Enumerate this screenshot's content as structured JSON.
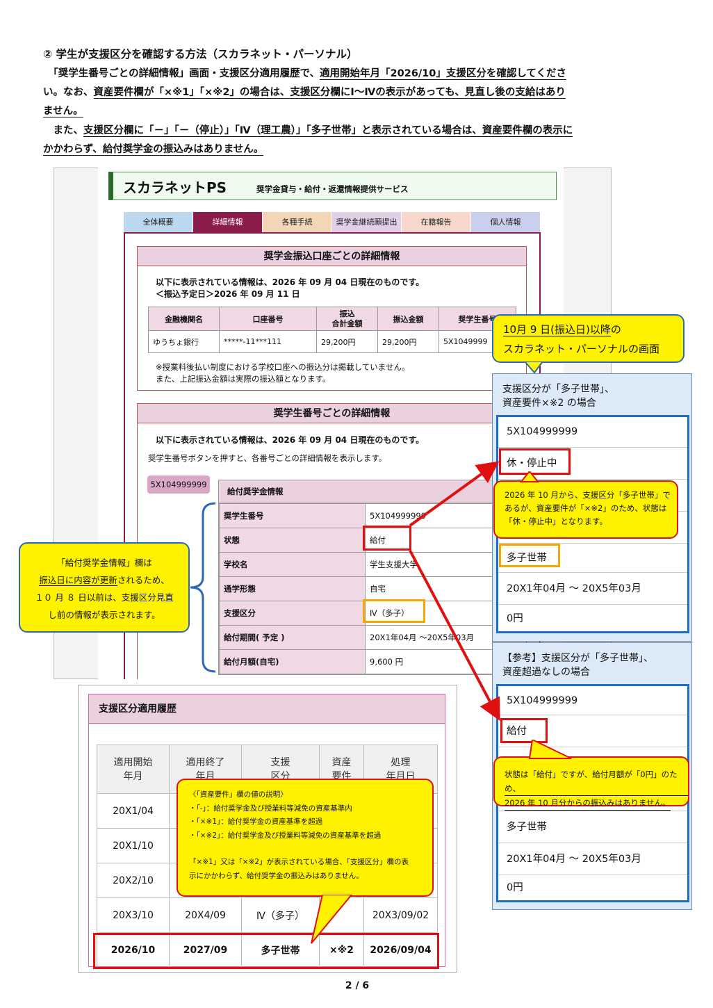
{
  "heading": "② 学生が支援区分を確認する方法（スカラネット・パーソナル）",
  "para1": {
    "a": "「奨学生番号ごとの詳細情報」画面・支援区分適用履歴で、",
    "b": "適用開始年月「2026/10」支援区分を確認してくださ",
    "c": "い。なお、",
    "d": "資産要件欄が「×※1」「×※2」の場合は、支援区分欄にⅠ～Ⅳの表示があっても、見直し後の支給はあり",
    "e": "ません。"
  },
  "para2": {
    "a": "また、",
    "b": "支援区分欄に「－」「－（停止）」「Ⅳ（理工農）」「多子世帯」と表示されている場合は、資産要件欄の表示に",
    "c": "かかわらず、給付奨学金の振込みはありません。"
  },
  "portal": {
    "brand": "スカラネットPS",
    "subtitle": "奨学金貸与・給付・返還情報提供サービス",
    "tabs": [
      "全体概要",
      "詳細情報",
      "各種手続",
      "奨学金継続願提出",
      "在籍報告",
      "個人情報"
    ],
    "tab_colors": [
      "#bcd8ee",
      "#8c1c4c",
      "#f3d6b8",
      "#e4cfe8",
      "#f8d8cc",
      "#c8d0ee"
    ],
    "account_section": {
      "title": "奨学金振込口座ごとの詳細情報",
      "note1": "以下に表示されている情報は、2026 年 09 月 04 日現在のものです。",
      "note2": "＜振込予定日＞2026 年 09 月 11 日",
      "headers": [
        "金融機関名",
        "口座番号",
        "振込\n合計金額",
        "振込金額",
        "奨学生番号"
      ],
      "row": [
        "ゆうちょ銀行",
        "*****-11***111",
        "29,200円",
        "29,200円",
        "5X1049999"
      ],
      "footnote1": "※授業料後払い制度における学校口座への振込分は掲載していません。",
      "footnote2": "また、上記振込金額は実際の振込額となります。"
    },
    "student_section": {
      "title": "奨学生番号ごとの詳細情報",
      "note1": "以下に表示されている情報は、2026 年 09 月 04 日現在のものです。",
      "note2": "奨学生番号ボタンを押すと、各番号ごとの詳細情報を表示します。",
      "button": "5X104999999"
    },
    "grant_info": {
      "title": "給付奨学金情報",
      "rows": [
        {
          "label": "奨学生番号",
          "value": "5X104999999"
        },
        {
          "label": "状態",
          "value": "給付"
        },
        {
          "label": "学校名",
          "value": "学生支援大学"
        },
        {
          "label": "通学形態",
          "value": "自宅"
        },
        {
          "label": "支援区分",
          "value": "Ⅳ（多子）"
        },
        {
          "label": "給付期間( 予定 )",
          "value": "20X1年04月 ～20X5年03月"
        },
        {
          "label": "給付月額(自宅)",
          "value": "9,600 円"
        }
      ]
    }
  },
  "left_callout": {
    "l1": "「給付奨学金情報」欄は",
    "l2a": "振込日に内容が更新",
    "l2b": "されるため、",
    "l3": "１０ 月 ８ 日以前は、支援区分見直",
    "l4": "し前の情報が表示されます。"
  },
  "top_callout": {
    "l1a": "10月 9 日(振込日)以降",
    "l1b": "の",
    "l2": "スカラネット・パーソナルの画面"
  },
  "panel1": {
    "caption1": "支援区分が「多子世帯」、",
    "caption2": "資産要件×※2 の場合",
    "rows": [
      "5X104999999",
      "休・停止中",
      "",
      "",
      "多子世帯",
      "20X1年04月 ～ 20X5年03月",
      "0円"
    ],
    "callout": [
      "2026 年 10 月から、支援区分「多子世帯」で",
      "あるが、資産要件が「×※2」のため、状態は",
      "「休・停止中」となります。"
    ]
  },
  "panel2": {
    "caption1": "【参考】支援区分が「多子世帯」、",
    "caption2": "資産超過なしの場合",
    "rows": [
      "5X104999999",
      "給付",
      "",
      "",
      "多子世帯",
      "20X1年04月 ～ 20X5年03月",
      "0円"
    ],
    "callout": [
      "状態は「給付」ですが、給付月額が「0円」のため、",
      "2026 年 10 月分からの振込みはありません。"
    ]
  },
  "history": {
    "title": "支援区分適用履歴",
    "headers": [
      "適用開始\n年月",
      "適用終了\n年月",
      "支援\n区分",
      "資産\n要件",
      "処理\n年月日"
    ],
    "rows": [
      [
        "20X1/04",
        "",
        "",
        "",
        ""
      ],
      [
        "20X1/10",
        "",
        "",
        "",
        ""
      ],
      [
        "20X2/10",
        "",
        "",
        "",
        ""
      ],
      [
        "20X3/10",
        "20X4/09",
        "Ⅳ（多子）",
        "",
        "20X3/09/02"
      ],
      [
        "2026/10",
        "2027/09",
        "多子世帯",
        "×※2",
        "2026/09/04"
      ]
    ],
    "callout": [
      "〈「資産要件」欄の値の説明〉",
      "・「-」：給付奨学金及び授業料等減免の資産基準内",
      "・「×※1」：給付奨学金の資産基準を超過",
      "・「×※2」：給付奨学金及び授業料等減免の資産基準を超過",
      "",
      "「×※1」又は「×※2」が表示されている場合、「支援区分」欄の表",
      "示にかかわらず、給付奨学金の振込みはありません。"
    ]
  },
  "page_number": "2 / 6"
}
